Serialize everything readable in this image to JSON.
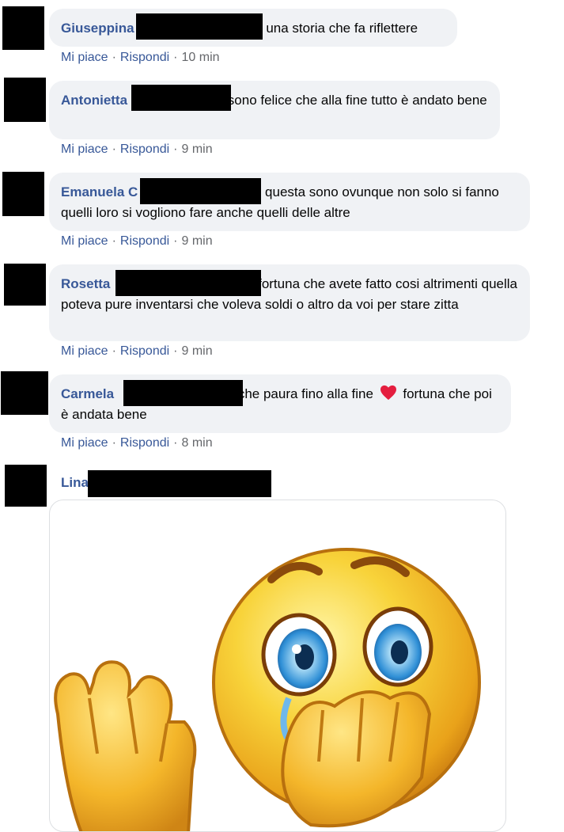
{
  "actions": {
    "like": "Mi piace",
    "reply": "Rispondi",
    "sep": "·"
  },
  "comments": [
    {
      "author": "Giuseppina",
      "text": "una storia che fa riflettere",
      "time": "10 min"
    },
    {
      "author": "Antonietta",
      "text": "sono felice che alla fine tutto è andato bene",
      "time": "9 min"
    },
    {
      "author": "Emanuela C",
      "text": "questa sono ovunque non solo si fanno quelli loro si vogliono fare anche quelli delle altre",
      "time": "9 min"
    },
    {
      "author": "Rosetta",
      "text": "fortuna che avete fatto cosi altrimenti quella poteva pure inventarsi che voleva soldi o altro da voi per stare zitta",
      "time": "9 min"
    },
    {
      "author": "Carmela",
      "text_before": "che paura fino alla fine",
      "text_after": "fortuna che poi è andata bene",
      "time": "8 min"
    },
    {
      "author": "Lina"
    }
  ],
  "colors": {
    "name": "#385898",
    "bubble": "#f0f2f5",
    "meta": "#65676b",
    "heart": "#e41e3f"
  },
  "icons": {
    "heart": "heart-emoji",
    "sticker": "crying-emoji-sticker"
  }
}
